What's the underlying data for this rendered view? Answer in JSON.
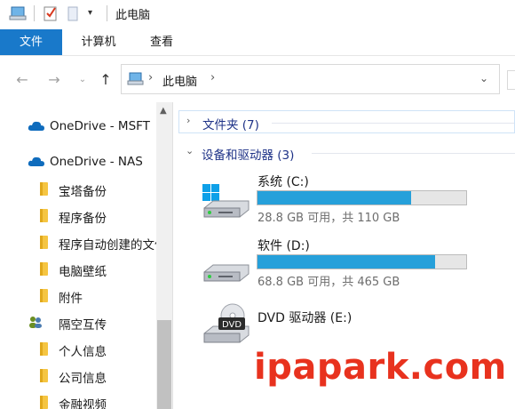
{
  "window": {
    "title": "此电脑"
  },
  "quick_access": [
    "computer-icon",
    "checkmark-icon",
    "page-icon",
    "dropdown-icon"
  ],
  "ribbon": {
    "tabs": [
      "文件",
      "计算机",
      "查看"
    ]
  },
  "address_bar": {
    "path": "此电脑"
  },
  "nav_pane": {
    "items": [
      {
        "label": "OneDrive - MSFT",
        "icon": "onedrive-cloud-icon"
      },
      {
        "label": "OneDrive - NAS",
        "icon": "onedrive-cloud-icon"
      },
      {
        "label": "宝塔备份",
        "icon": "folder-icon"
      },
      {
        "label": "程序备份",
        "icon": "folder-icon"
      },
      {
        "label": "程序自动创建的文件",
        "icon": "folder-icon"
      },
      {
        "label": "电脑壁纸",
        "icon": "folder-icon"
      },
      {
        "label": "附件",
        "icon": "folder-icon"
      },
      {
        "label": "隔空互传",
        "icon": "people-icon"
      },
      {
        "label": "个人信息",
        "icon": "folder-icon"
      },
      {
        "label": "公司信息",
        "icon": "folder-icon"
      },
      {
        "label": "金融视频",
        "icon": "folder-icon"
      }
    ]
  },
  "content": {
    "groups": [
      {
        "label": "文件夹 (7)",
        "expanded": false
      },
      {
        "label": "设备和驱动器 (3)",
        "expanded": true
      }
    ],
    "drives": [
      {
        "name": "系统 (C:)",
        "info": "28.8 GB 可用，共 110 GB",
        "used_fraction": 0.738,
        "icon": "windows-drive-icon"
      },
      {
        "name": "软件 (D:)",
        "info": "68.8 GB 可用，共 465 GB",
        "used_fraction": 0.852,
        "icon": "hard-drive-icon"
      },
      {
        "name": "DVD 驱动器 (E:)",
        "info": "",
        "icon": "dvd-drive-icon"
      }
    ]
  },
  "watermark": "ipapark.com",
  "colors": {
    "accent": "#1979ca",
    "bar_fill": "#26a0da",
    "group_text": "#1e3287",
    "watermark": "#e8321e"
  }
}
